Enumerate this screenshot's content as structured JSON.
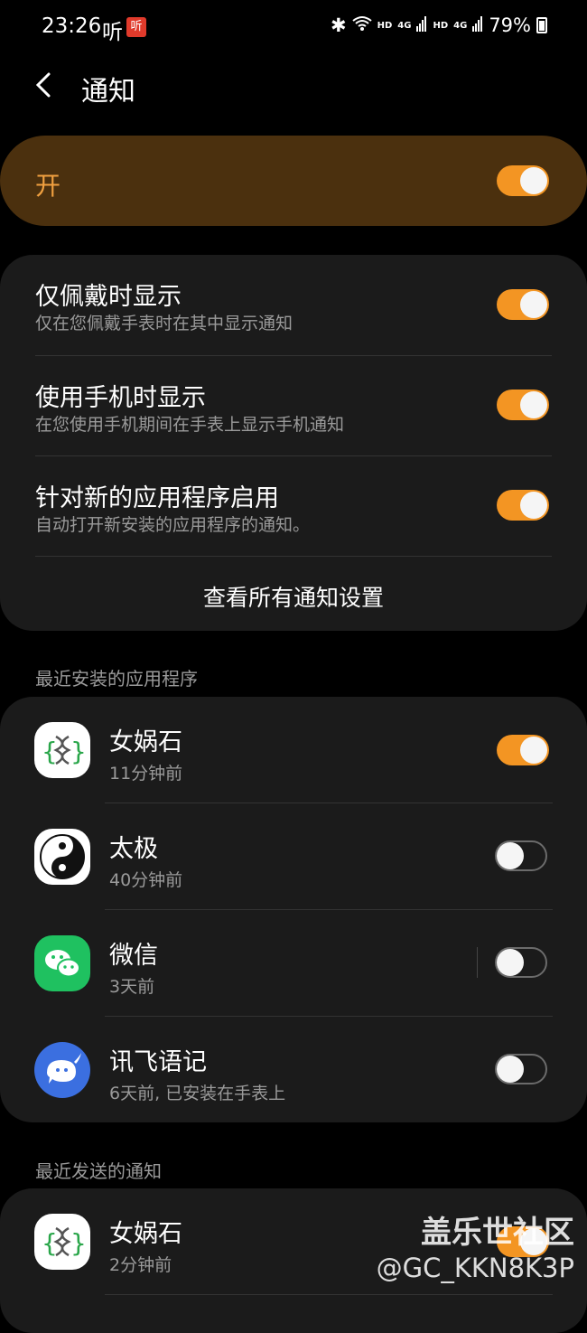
{
  "status": {
    "time": "23:26",
    "ting": "听",
    "ting_badge": "听",
    "hd1": "HD",
    "g1": "4G",
    "hd2": "HD",
    "g2": "4G",
    "battery": "79%"
  },
  "header": {
    "title": "通知"
  },
  "master": {
    "label": "开",
    "on": true
  },
  "settings": {
    "rows": [
      {
        "title": "仅佩戴时显示",
        "subtitle": "仅在您佩戴手表时在其中显示通知",
        "on": true
      },
      {
        "title": "使用手机时显示",
        "subtitle": "在您使用手机期间在手表上显示手机通知",
        "on": true
      },
      {
        "title": "针对新的应用程序启用",
        "subtitle": "自动打开新安装的应用程序的通知。",
        "on": true
      }
    ],
    "link": "查看所有通知设置"
  },
  "recent_installed": {
    "label": "最近安装的应用程序",
    "apps": [
      {
        "name": "女娲石",
        "time": "11分钟前",
        "icon": "dna-icon",
        "on": true
      },
      {
        "name": "太极",
        "time": "40分钟前",
        "icon": "taichi-icon",
        "on": false
      },
      {
        "name": "微信",
        "time": "3天前",
        "icon": "wechat-icon",
        "on": false
      },
      {
        "name": "讯飞语记",
        "time": "6天前, 已安装在手表上",
        "icon": "whale-icon",
        "on": false
      }
    ]
  },
  "recent_sent": {
    "label": "最近发送的通知",
    "apps": [
      {
        "name": "女娲石",
        "time": "2分钟前",
        "icon": "dna-icon",
        "on": true
      }
    ]
  },
  "watermark": {
    "line1": "盖乐世社区",
    "line2": "@GC_KKN8K3P"
  },
  "colors": {
    "accent": "#f39523",
    "master_bg": "#4b300e",
    "card_bg": "#1b1b1b",
    "wechat": "#1fc160",
    "xunfei": "#3b6fe0"
  }
}
